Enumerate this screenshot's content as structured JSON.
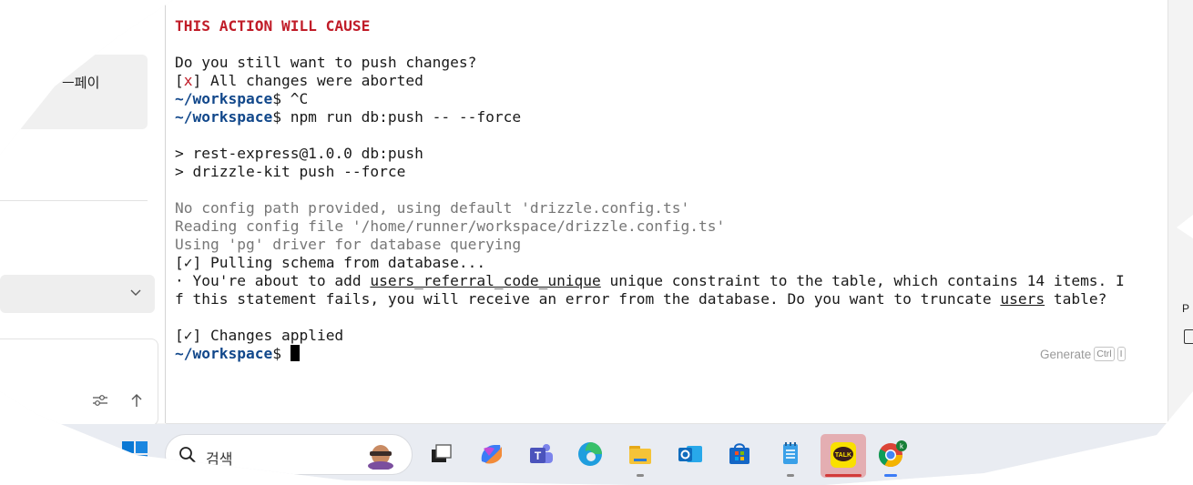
{
  "sidebar": {
    "card_label": "ㅡ페이",
    "select_chevron_icon": "chevron-down-icon",
    "tune_icon": "tune-icon",
    "up_icon": "arrow-up-icon"
  },
  "terminal": {
    "line1": "THIS ACTION WILL CAUSE",
    "line3": "Do you still want to push changes?",
    "line4_mark": "x",
    "line4_text": " All changes were aborted",
    "prompt": "~/workspace",
    "line5_cmd": "$ ^C",
    "line6_cmd": "$ npm run db:push -- --force",
    "line8": "> rest-express@1.0.0 db:push",
    "line9": "> drizzle-kit push --force",
    "line11": "No config path provided, using default 'drizzle.config.ts'",
    "line12": "Reading config file '/home/runner/workspace/drizzle.config.ts'",
    "line13": "Using 'pg' driver for database querying",
    "check": "✓",
    "line14_text": " Pulling schema from database...",
    "line15_a": "· You're about to add ",
    "line15_u": "users_referral_code_unique",
    "line15_b": " unique constraint to the table, which contains 14 items. I",
    "line16_a": "f this statement fails, you will receive an error from the database. Do you want to truncate ",
    "line16_u": "users",
    "line16_b": " table?",
    "line18_text": " Changes applied",
    "line19_cmd": "$ ",
    "generate_label": "Generate",
    "generate_key1": "Ctrl",
    "generate_key2": "I"
  },
  "right_edge": {
    "letter": "P"
  },
  "taskbar": {
    "search_label": "검색",
    "icons": [
      "windows-start-icon",
      "search-icon",
      "copilot-avatar-icon",
      "task-view-icon",
      "copilot-icon",
      "teams-icon",
      "edge-icon",
      "file-explorer-icon",
      "outlook-icon",
      "microsoft-store-icon",
      "notepad-icon",
      "kakaotalk-icon",
      "chrome-icon"
    ],
    "kakao_label": "TALK",
    "chrome_badge": "k"
  }
}
